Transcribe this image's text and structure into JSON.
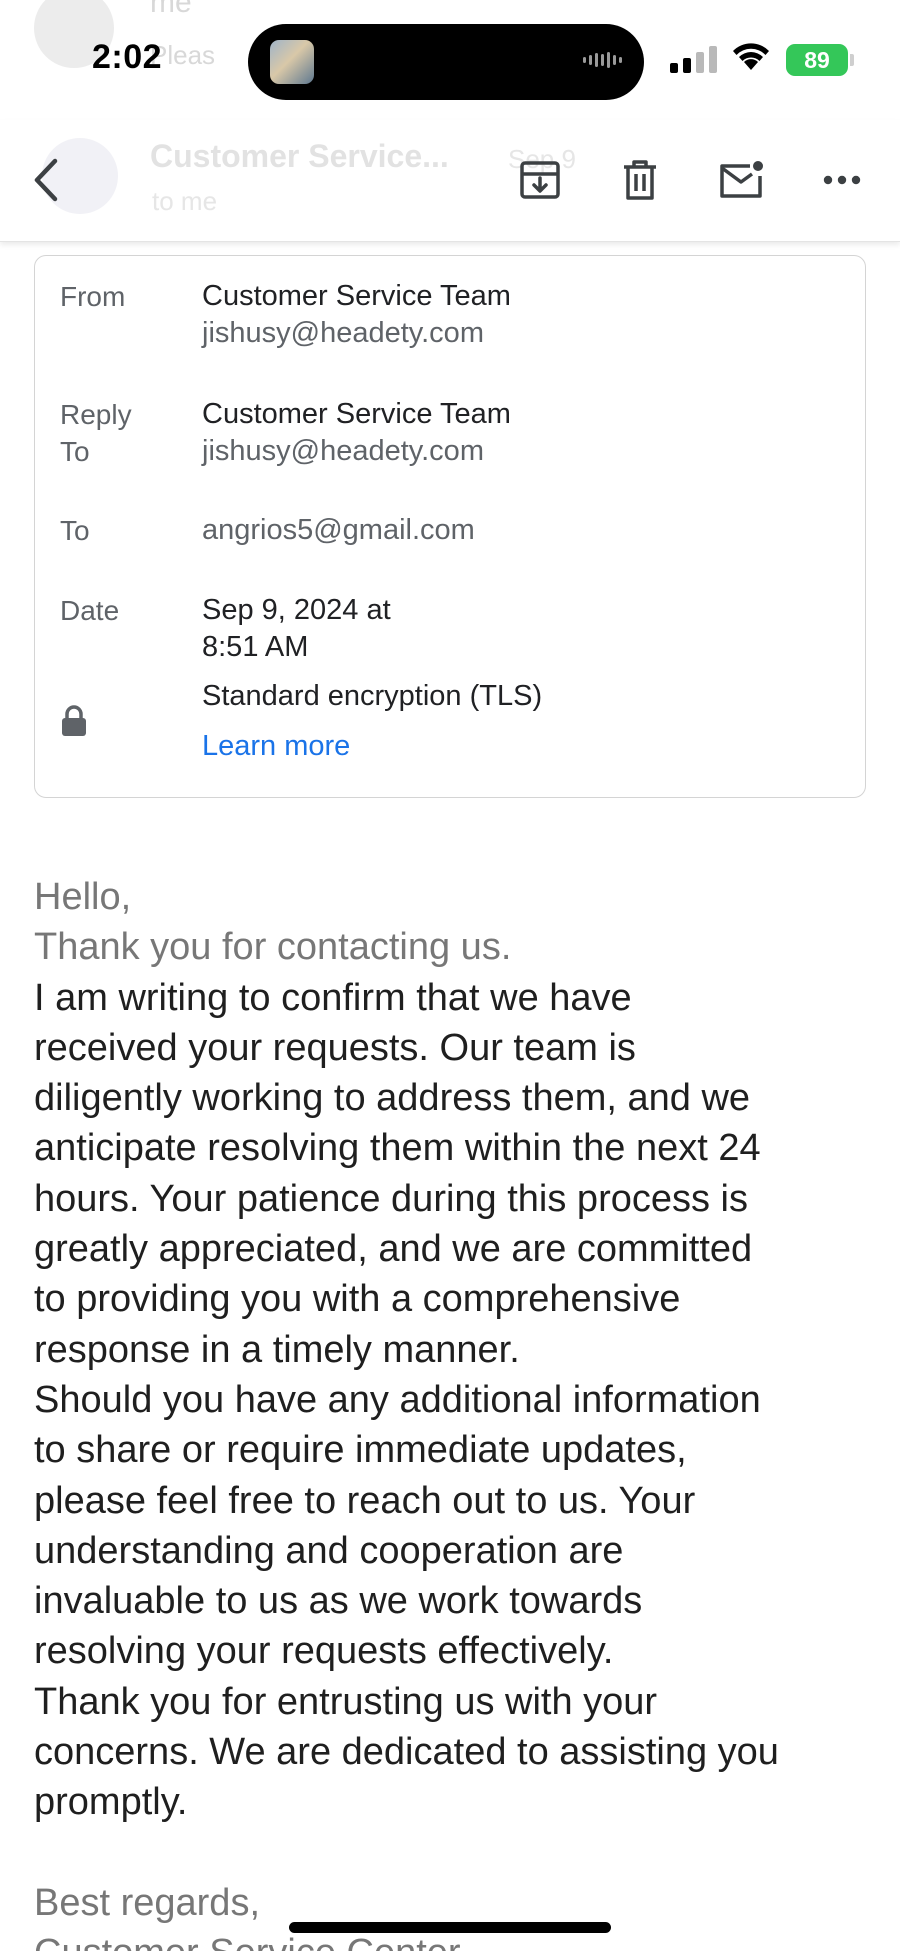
{
  "status_bar": {
    "time": "2:02",
    "battery": "89",
    "battery_color": "#34c759"
  },
  "background_header": {
    "list_sender_fragment": "me",
    "list_subject_fragment": "Pleas",
    "sender_name": "Customer Service...",
    "date_fragment": "Sep 9",
    "to_line": "to me"
  },
  "toolbar": {
    "back_icon": "chevron-left-icon",
    "archive_icon": "archive-icon",
    "delete_icon": "trash-icon",
    "mark_unread_icon": "mail-unread-icon",
    "more_icon": "more-horizontal-icon"
  },
  "details": {
    "from_label": "From",
    "from_name": "Customer Service Team",
    "from_email": "jishusy@headety.com",
    "reply_to_label": "Reply\nTo",
    "reply_to_name": "Customer Service Team",
    "reply_to_email": "jishusy@headety.com",
    "to_label": "To",
    "to_email": "angrios5@gmail.com",
    "date_label": "Date",
    "date_value": "Sep 9, 2024 at\n8:51 AM",
    "encryption": "Standard encryption (TLS)",
    "learn_more": "Learn more",
    "link_color": "#1a73e8"
  },
  "body": {
    "greeting": "Hello,",
    "intro": "Thank you for contacting us.",
    "paragraph1": "I am writing to confirm that we have\nreceived your requests. Our team is\ndiligently working to address them, and we\nanticipate resolving them within the next 24\nhours. Your patience during this process is\ngreatly appreciated, and we are committed\nto providing you with a comprehensive\nresponse in a timely manner.",
    "paragraph2": "Should you have any additional information\nto share or require immediate updates,\nplease feel free to reach out to us. Your\nunderstanding and cooperation are\ninvaluable to us as we work towards\nresolving your requests effectively.",
    "paragraph3": "Thank you for entrusting us with your\nconcerns. We are dedicated to assisting you\npromptly.",
    "closing": "Best regards,",
    "signature": "Customer Service Center"
  }
}
